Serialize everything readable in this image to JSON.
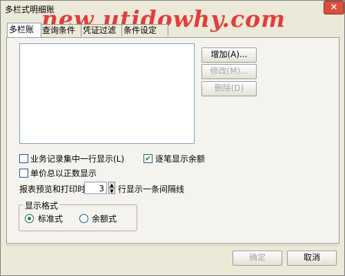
{
  "window": {
    "title": "多栏式明细账",
    "close_label": "×"
  },
  "watermark": "new utidowhy.com",
  "tabs": [
    {
      "label": "多栏账",
      "active": true
    },
    {
      "label": "查询条件",
      "active": false
    },
    {
      "label": "凭证过滤",
      "active": false
    },
    {
      "label": "条件设定",
      "active": false
    }
  ],
  "side_buttons": {
    "add": "增加(A)...",
    "modify": "修改(M)...",
    "delete": "删除(D)"
  },
  "options": {
    "single_line": {
      "label": "业务记录集中一行显示(L)",
      "checked": false
    },
    "show_balance": {
      "label": "逐笔显示余额",
      "checked": true
    },
    "positive_price": {
      "label": "单价总以正数显示",
      "checked": false
    }
  },
  "interval": {
    "prefix": "报表预览和打印时",
    "value": "3",
    "suffix": "行显示一条间隔线"
  },
  "display_format": {
    "legend": "显示格式",
    "options": [
      {
        "label": "标准式",
        "selected": true
      },
      {
        "label": "余额式",
        "selected": false
      }
    ]
  },
  "footer": {
    "ok": "确定",
    "cancel": "取消"
  },
  "colors": {
    "watermark": "#dd2222",
    "check": "#1d8a1d"
  }
}
